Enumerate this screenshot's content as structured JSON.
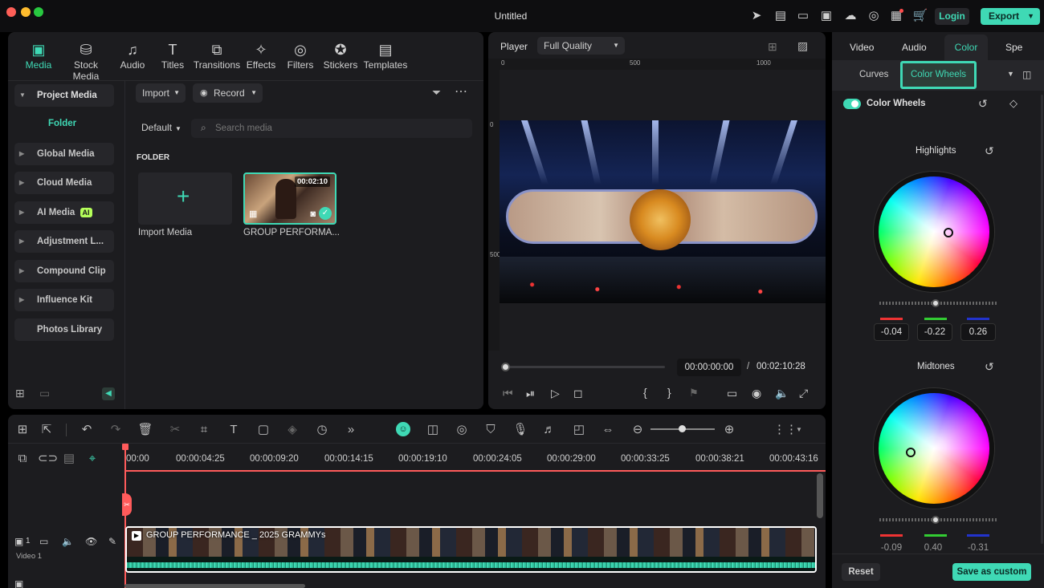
{
  "window": {
    "title": "Untitled"
  },
  "header": {
    "login_label": "Login",
    "export_label": "Export"
  },
  "media_toolbar": {
    "tabs": [
      {
        "label": "Media",
        "icon": "media-icon"
      },
      {
        "label": "Stock Media",
        "icon": "stock-media-icon"
      },
      {
        "label": "Audio",
        "icon": "music-note-icon"
      },
      {
        "label": "Titles",
        "icon": "text-t-icon"
      },
      {
        "label": "Transitions",
        "icon": "transitions-icon"
      },
      {
        "label": "Effects",
        "icon": "effects-icon"
      },
      {
        "label": "Filters",
        "icon": "filters-icon"
      },
      {
        "label": "Stickers",
        "icon": "stickers-icon"
      },
      {
        "label": "Templates",
        "icon": "templates-icon"
      }
    ]
  },
  "sidebar": {
    "project_media": "Project Media",
    "folder": "Folder",
    "items": [
      {
        "label": "Global Media"
      },
      {
        "label": "Cloud Media"
      },
      {
        "label": "AI Media",
        "badge": "AI"
      },
      {
        "label": "Adjustment L..."
      },
      {
        "label": "Compound Clip"
      },
      {
        "label": "Influence Kit"
      },
      {
        "label": "Photos Library"
      }
    ]
  },
  "media_panel": {
    "import_label": "Import",
    "record_label": "Record",
    "sort_label": "Default",
    "search_placeholder": "Search media",
    "folder_heading": "FOLDER",
    "import_media_label": "Import Media",
    "clip_name": "GROUP PERFORMA...",
    "clip_duration": "00:02:10"
  },
  "player": {
    "label": "Player",
    "quality": "Full Quality",
    "ruler_top": [
      "0",
      "500",
      "1000"
    ],
    "ruler_left": [
      "0",
      "500"
    ],
    "current_time": "00:00:00:00",
    "separator": "/",
    "total_time": "00:02:10:28"
  },
  "color_panel": {
    "tabs": [
      "Video",
      "Audio",
      "Color",
      "Spe"
    ],
    "subtabs": [
      "Curves",
      "Color Wheels"
    ],
    "toggle_label": "Color Wheels",
    "highlights": {
      "label": "Highlights",
      "values": [
        "-0.04",
        "-0.22",
        "0.26"
      ]
    },
    "midtones": {
      "label": "Midtones",
      "values": [
        "-0.09",
        "0.40",
        "-0.31"
      ]
    },
    "reset_label": "Reset",
    "save_label": "Save as custom"
  },
  "timeline": {
    "ruler": [
      "00:00",
      "00:00:04:25",
      "00:00:09:20",
      "00:00:14:15",
      "00:00:19:10",
      "00:00:24:05",
      "00:00:29:00",
      "00:00:33:25",
      "00:00:38:21",
      "00:00:43:16"
    ],
    "clip_title": "GROUP PERFORMANCE _ 2025 GRAMMYs",
    "track_label": "Video 1",
    "track_number": "1"
  },
  "colors": {
    "accent": "#3fd9b5",
    "playhead": "#ff5b5b"
  }
}
